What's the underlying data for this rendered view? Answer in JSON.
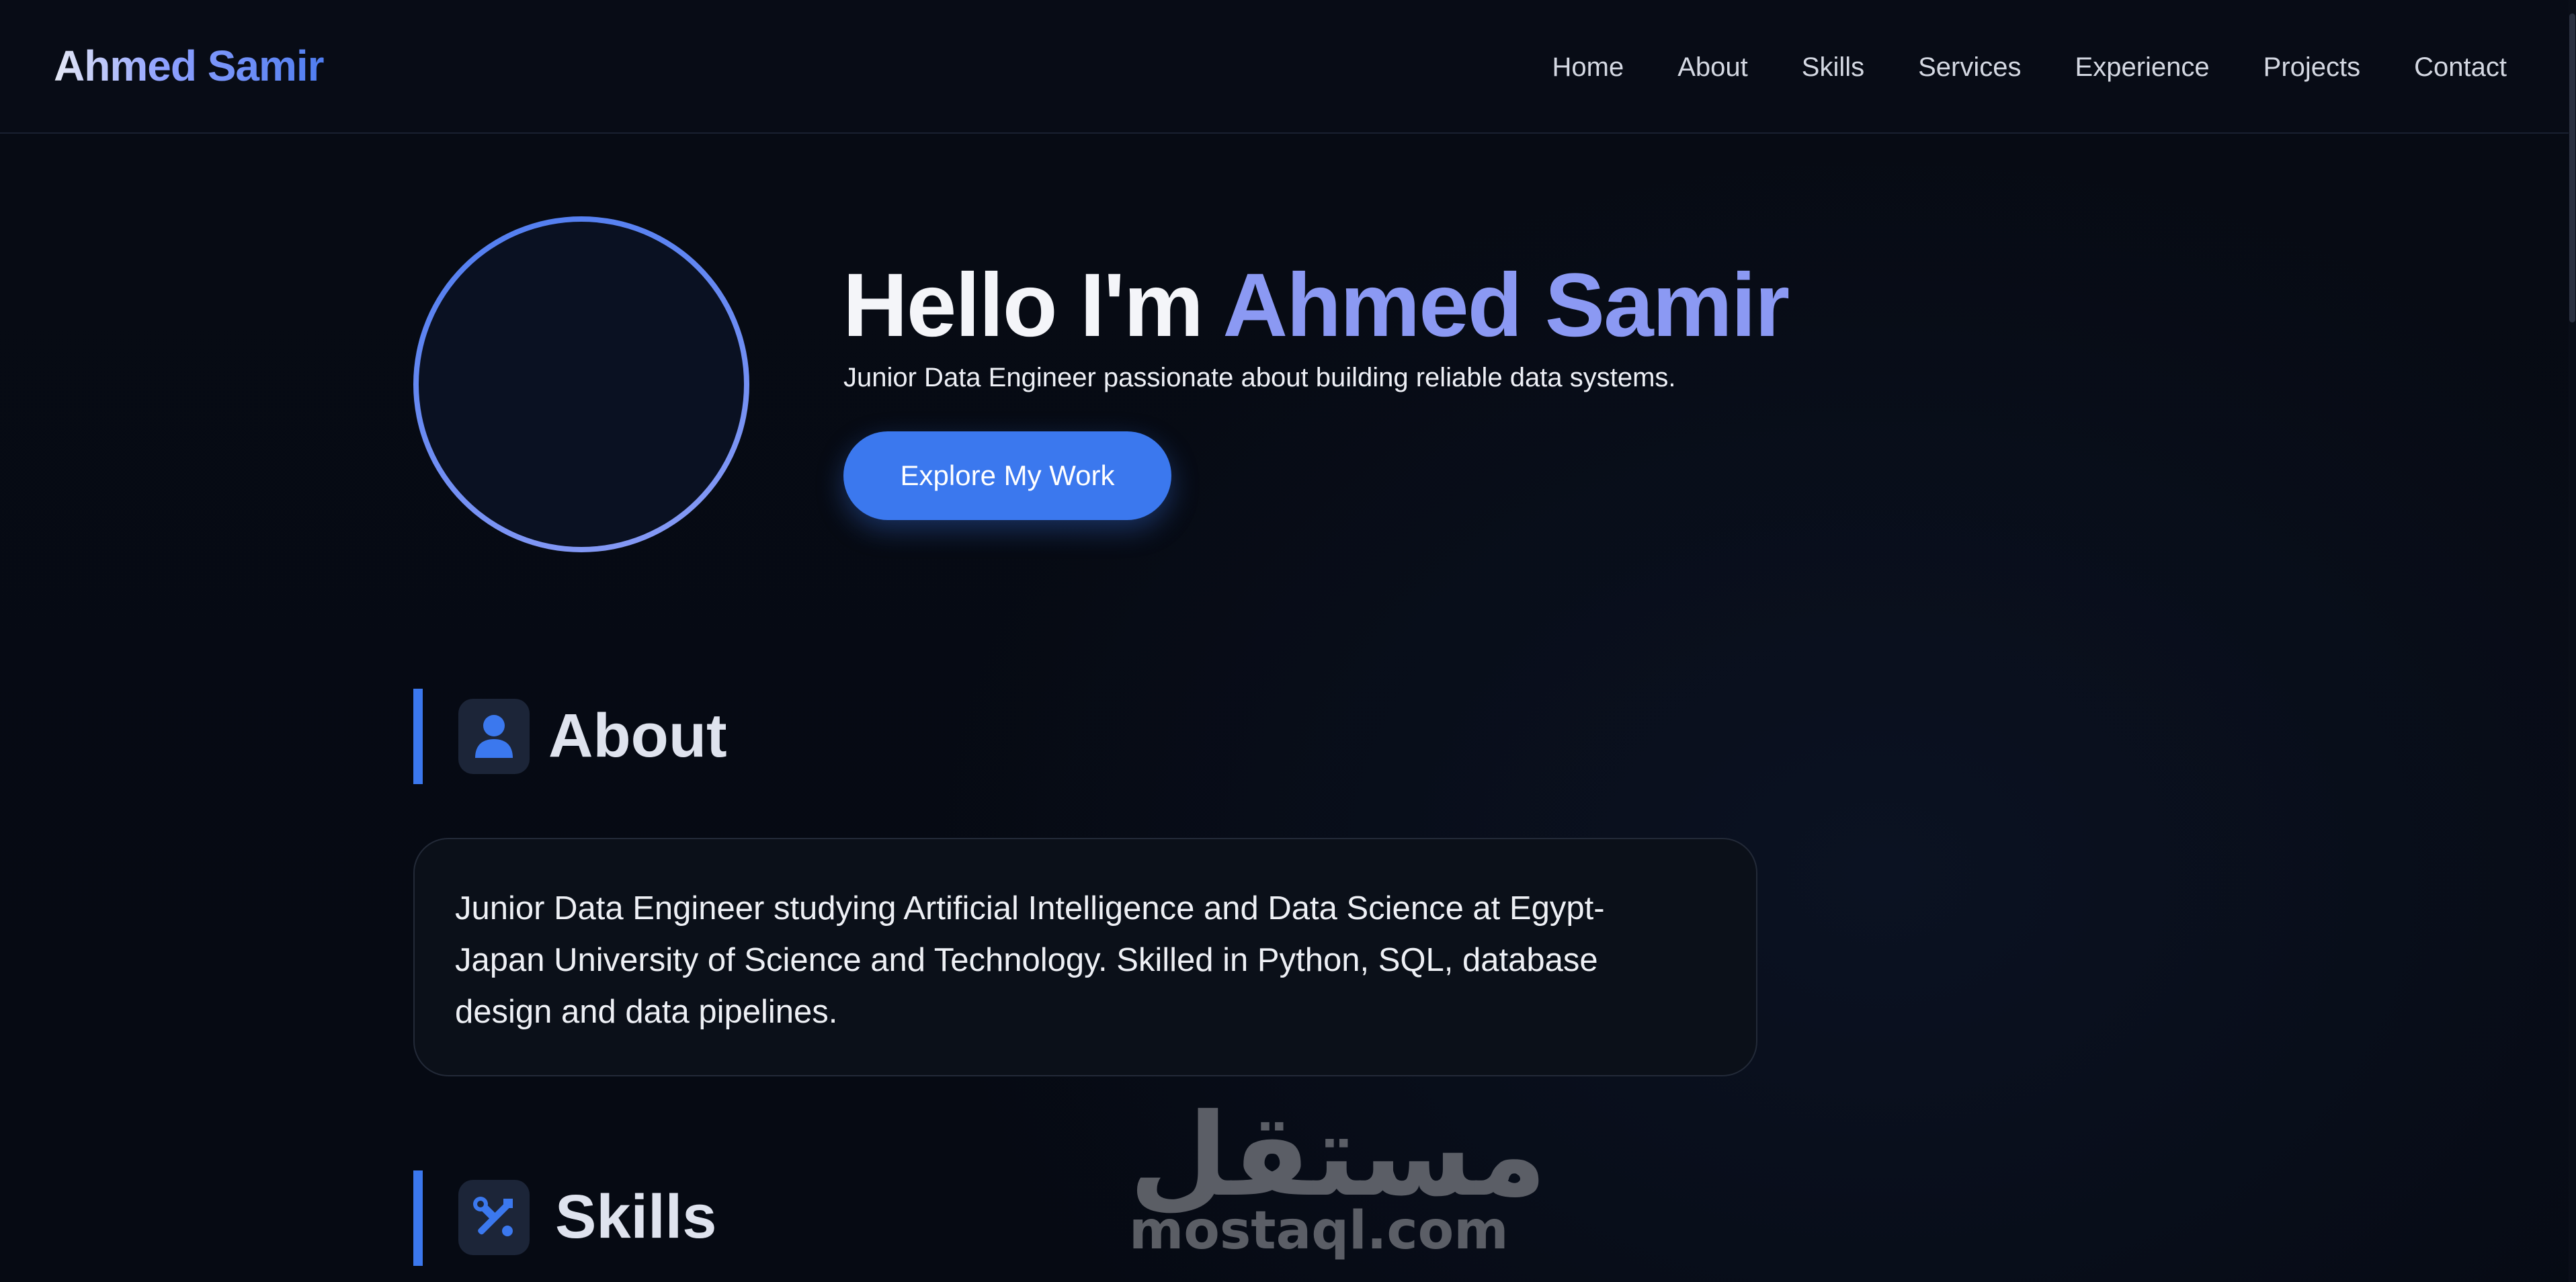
{
  "brand": {
    "name": "Ahmed Samir"
  },
  "nav": {
    "links": [
      "Home",
      "About",
      "Skills",
      "Services",
      "Experience",
      "Projects",
      "Contact"
    ]
  },
  "hero": {
    "greeting": "Hello I'm",
    "name": "Ahmed Samir",
    "subtitle": "Junior Data Engineer passionate about building reliable data systems.",
    "button_label": "Explore My Work"
  },
  "about": {
    "title": "About",
    "icon": "user-icon",
    "text": "Junior Data Engineer studying Artificial Intelligence and Data Science at Egypt-Japan University of Science and Technology. Skilled in Python, SQL, database design and data pipelines."
  },
  "skills": {
    "title": "Skills",
    "icon": "tools-icon"
  },
  "watermark": {
    "arabic": "مستقل",
    "latin": "mostaql.com"
  },
  "colors": {
    "accent": "#3b78ee",
    "name_accent": "#8b99f3",
    "background": "#070b14"
  }
}
